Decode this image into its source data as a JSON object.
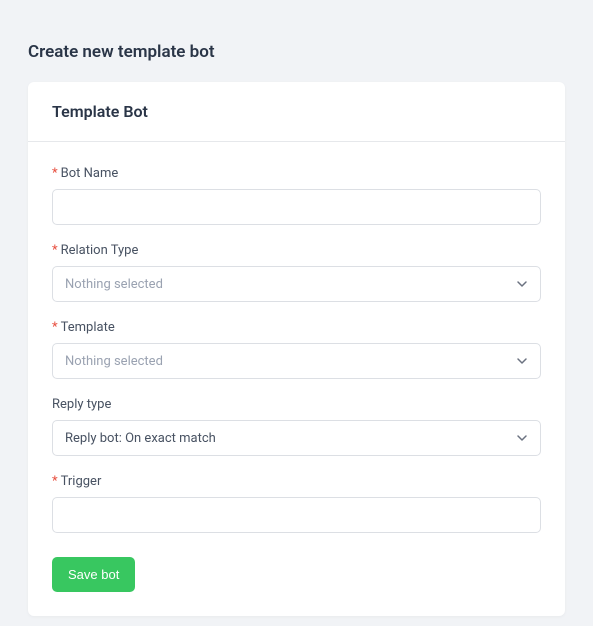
{
  "page": {
    "title": "Create new template bot"
  },
  "card": {
    "header": "Template Bot"
  },
  "form": {
    "botName": {
      "label": "Bot Name",
      "value": ""
    },
    "relationType": {
      "label": "Relation Type",
      "selected": "Nothing selected"
    },
    "template": {
      "label": "Template",
      "selected": "Nothing selected"
    },
    "replyType": {
      "label": "Reply type",
      "selected": "Reply bot: On exact match"
    },
    "trigger": {
      "label": "Trigger",
      "value": ""
    },
    "saveButton": "Save bot"
  }
}
